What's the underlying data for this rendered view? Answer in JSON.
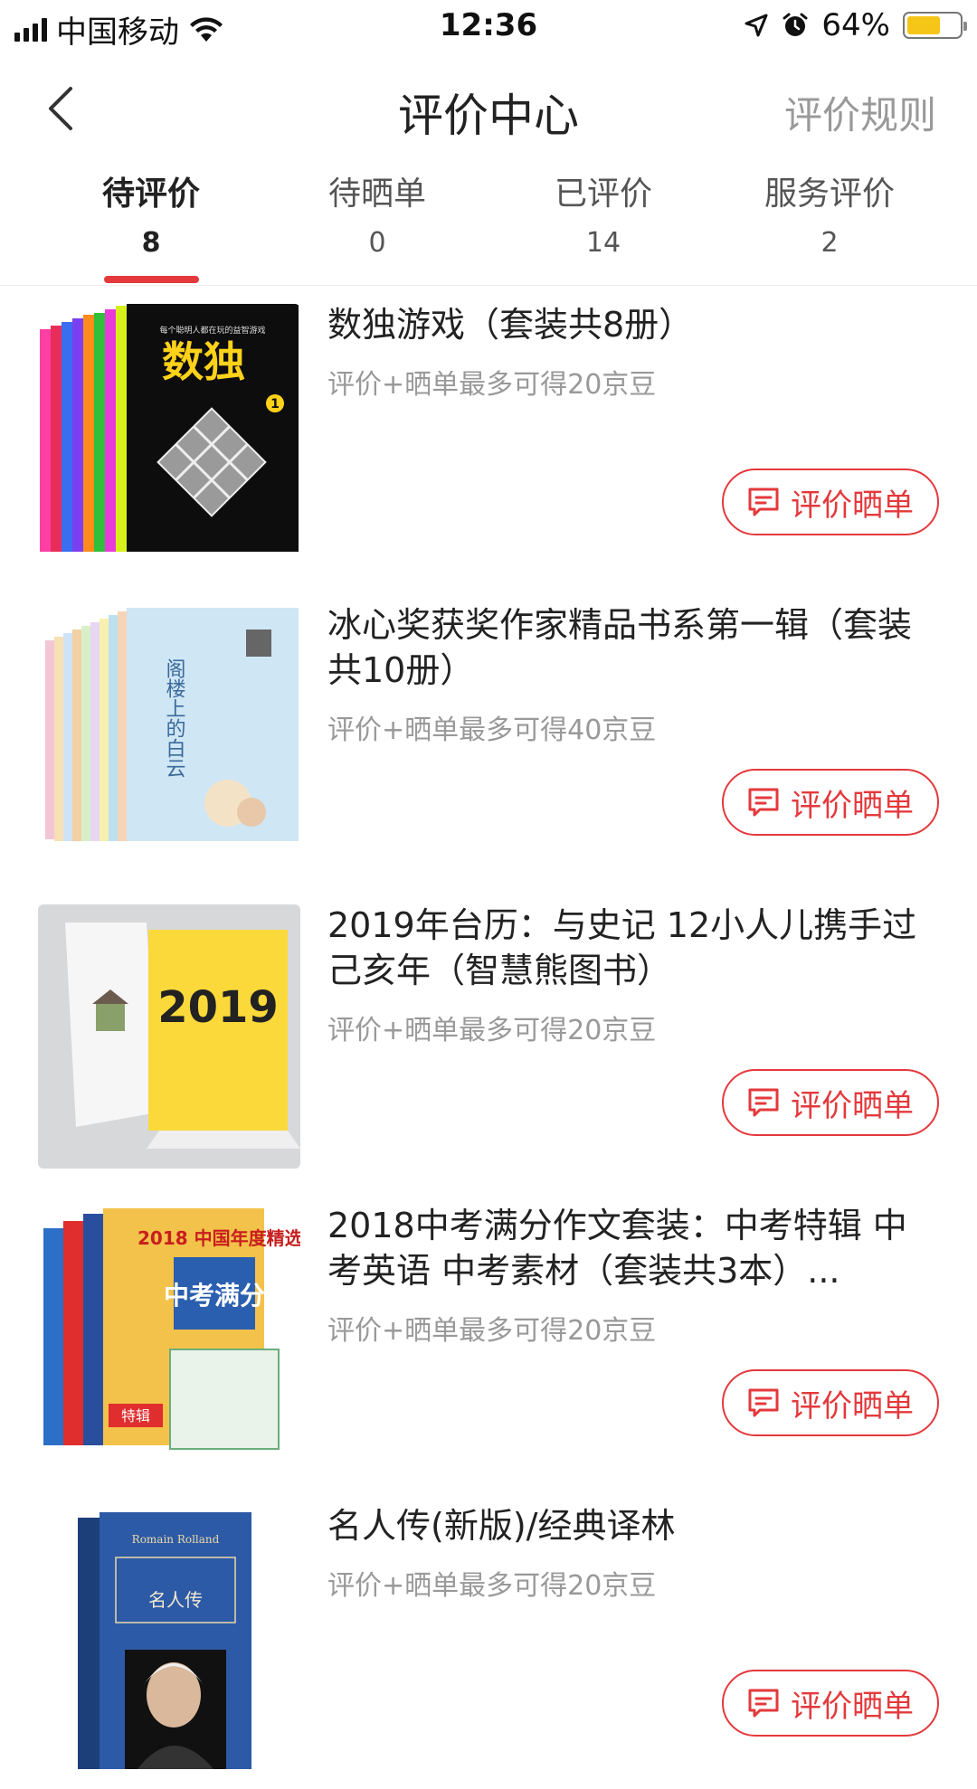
{
  "status_bar": {
    "carrier": "中国移动",
    "time": "12:36",
    "battery_percent": "64%",
    "battery_level": 0.64,
    "battery_color": "#f5c518",
    "icons": [
      "signal-icon",
      "wifi-icon",
      "location-arrow-icon",
      "alarm-icon",
      "battery-icon"
    ]
  },
  "navbar": {
    "title": "评价中心",
    "rules_link": "评价规则",
    "back_icon": "chevron-left-icon"
  },
  "tabs": [
    {
      "label": "待评价",
      "count": "8",
      "active": true
    },
    {
      "label": "待晒单",
      "count": "0",
      "active": false
    },
    {
      "label": "已评价",
      "count": "14",
      "active": false
    },
    {
      "label": "服务评价",
      "count": "2",
      "active": false
    }
  ],
  "accent_color": "#e4393c",
  "items": [
    {
      "title": "数独游戏（套装共8册）",
      "subtitle": "评价+晒单最多可得20京豆",
      "button": "评价晒单",
      "cover": {
        "big_text": "数独",
        "small_text": "每个聪明人都在玩的益智游戏",
        "badge": "1"
      }
    },
    {
      "title": "冰心奖获奖作家精品书系第一辑（套装共10册）",
      "subtitle": "评价+晒单最多可得40京豆",
      "button": "评价晒单",
      "cover": {
        "big_text": "阁楼上的白云"
      }
    },
    {
      "title": "2019年台历：与史记 12小人儿携手过己亥年（智慧熊图书）",
      "subtitle": "评价+晒单最多可得20京豆",
      "button": "评价晒单",
      "cover": {
        "big_text": "2019"
      }
    },
    {
      "title": "2018中考满分作文套装：中考特辑 中考英语 中考素材（套装共3本）...",
      "subtitle": "评价+晒单最多可得20京豆",
      "button": "评价晒单",
      "cover": {
        "big_text": "中考满分",
        "small_text": "2018 中国年度精选",
        "badge": "特辑"
      }
    },
    {
      "title": "名人传(新版)/经典译林",
      "subtitle": "评价+晒单最多可得20京豆",
      "button": "评价晒单",
      "cover": {
        "big_text": "名人传",
        "small_text": "Romain Rolland"
      }
    }
  ]
}
